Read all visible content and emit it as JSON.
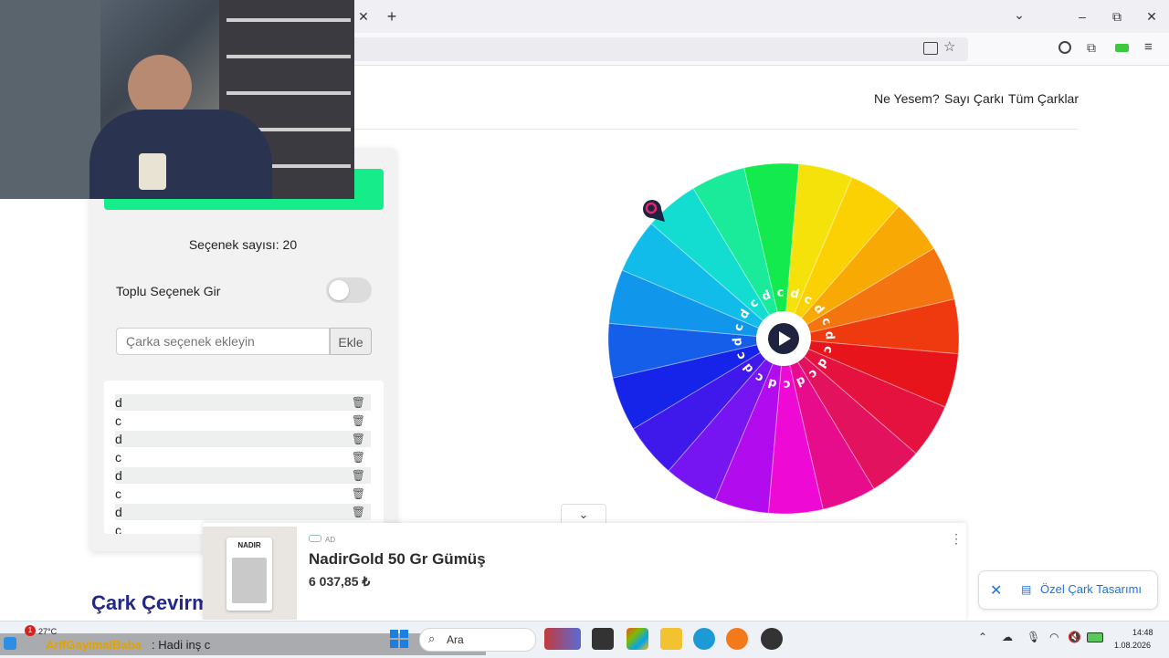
{
  "browser": {
    "close_tab": "✕",
    "new_tab": "+",
    "tab_list": "⌄",
    "minimize": "–",
    "restore": "⧉",
    "close_window": "✕"
  },
  "nav": {
    "links": [
      "Ne Yesem?",
      "Sayı Çarkı",
      "Tüm Çarklar"
    ]
  },
  "panel": {
    "count_label": "Seçenek sayısı: 20",
    "bulk_label": "Toplu Seçenek Gir",
    "bulk_enabled": false,
    "input_placeholder": "Çarka seçenek ekleyin",
    "add_button": "Ekle",
    "items": [
      "d",
      "c",
      "d",
      "c",
      "d",
      "c",
      "d",
      "c"
    ]
  },
  "wheel": {
    "labels": [
      "d",
      "c",
      "d",
      "c",
      "d",
      "c",
      "d",
      "c",
      "d",
      "c",
      "d",
      "c",
      "d",
      "c",
      "d",
      "c",
      "d",
      "c",
      "d",
      "c"
    ],
    "colors": [
      "#f5e20a",
      "#fbd103",
      "#f9a904",
      "#f47510",
      "#ef3a10",
      "#e8141c",
      "#e51240",
      "#e3125e",
      "#e70c8c",
      "#ee0ad4",
      "#b20cee",
      "#7714f2",
      "#3f19ec",
      "#1624e9",
      "#145eea",
      "#1096ea",
      "#11bceb",
      "#13ddd1",
      "#19eb9a",
      "#12ea4e"
    ]
  },
  "ad": {
    "badge": "AD",
    "title": "NadirGold 50 Gr Gümüş",
    "price": "6 037,85 ₺",
    "image_brand": "NADIR",
    "menu": "⋮"
  },
  "page": {
    "heading": "Çark Çevirm"
  },
  "custom_wheel": {
    "close": "✕",
    "label": "Özel Çark Tasarımı"
  },
  "chat": {
    "user": "ArifGayimalBaba",
    "message": ": Hadi inş c"
  },
  "taskbar": {
    "weather": "27°C",
    "badge": "1",
    "search": "Ara",
    "time": "14:48",
    "date": "1.08.2026"
  },
  "colors": {
    "accent_green": "#17ec8a",
    "heading_blue": "#22288a",
    "link_blue": "#1a73e8"
  }
}
